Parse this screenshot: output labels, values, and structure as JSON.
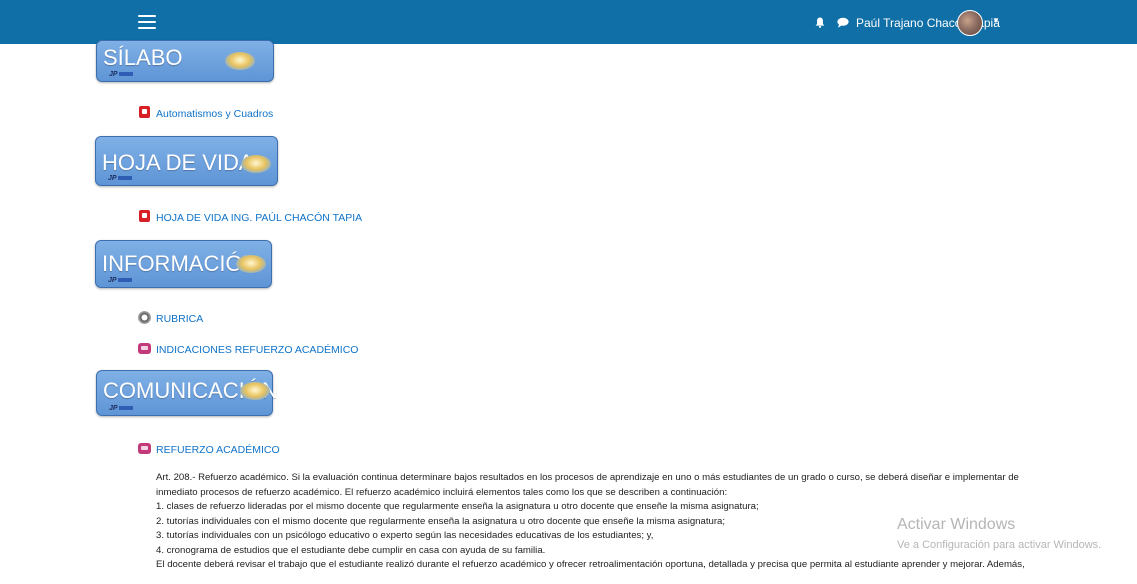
{
  "header": {
    "user_name": "Paúl Trajano Chacón Tapia",
    "icons": [
      "menu-icon",
      "bell-icon",
      "chat-icon",
      "caret-down-icon"
    ],
    "bg_color": "#0f6fa6"
  },
  "sections": {
    "silabo": {
      "title": "SÍLABO",
      "sig": "JP",
      "resource": "Automatismos y Cuadros"
    },
    "hoja": {
      "title": "HOJA DE VIDA",
      "sig": "JP",
      "resource": "HOJA DE VIDA ING. PAÚL CHACÓN TAPIA"
    },
    "info": {
      "title": "INFORMACIÓN",
      "sig": "JP",
      "resources": [
        "RUBRICA",
        "INDICACIONES REFUERZO ACADÉMICO"
      ]
    },
    "comu": {
      "title": "COMUNICACIÓN",
      "sig": "JP",
      "resource": "REFUERZO ACADÉMICO"
    }
  },
  "article": {
    "lines": [
      "Art. 208.- Refuerzo académico. Si la evaluación continua determinare bajos resultados en los procesos de aprendizaje en uno o más estudiantes de un grado o curso, se deberá diseñar e implementar de",
      "inmediato procesos de refuerzo académico. El refuerzo académico incluirá elementos tales como los que se describen a continuación:",
      "1. clases de refuerzo lideradas por el mismo docente que regularmente enseña la asignatura u otro docente que enseñe la misma asignatura;",
      "2. tutorías individuales con el mismo docente que regularmente enseña la asignatura u otro docente que enseñe la misma asignatura;",
      "3. tutorías individuales con un psicólogo educativo o experto según las necesidades educativas de los estudiantes; y,",
      "4. cronograma de estudios que el estudiante debe cumplir en casa con ayuda de su familia.",
      "El docente deberá revisar el trabajo que el estudiante realizó durante el refuerzo académico y ofrecer retroalimentación oportuna, detallada y precisa que permita al estudiante aprender y mejorar. Además,"
    ]
  },
  "watermark": {
    "title": "Activar Windows",
    "subtitle": "Ve a Configuración para activar Windows."
  }
}
